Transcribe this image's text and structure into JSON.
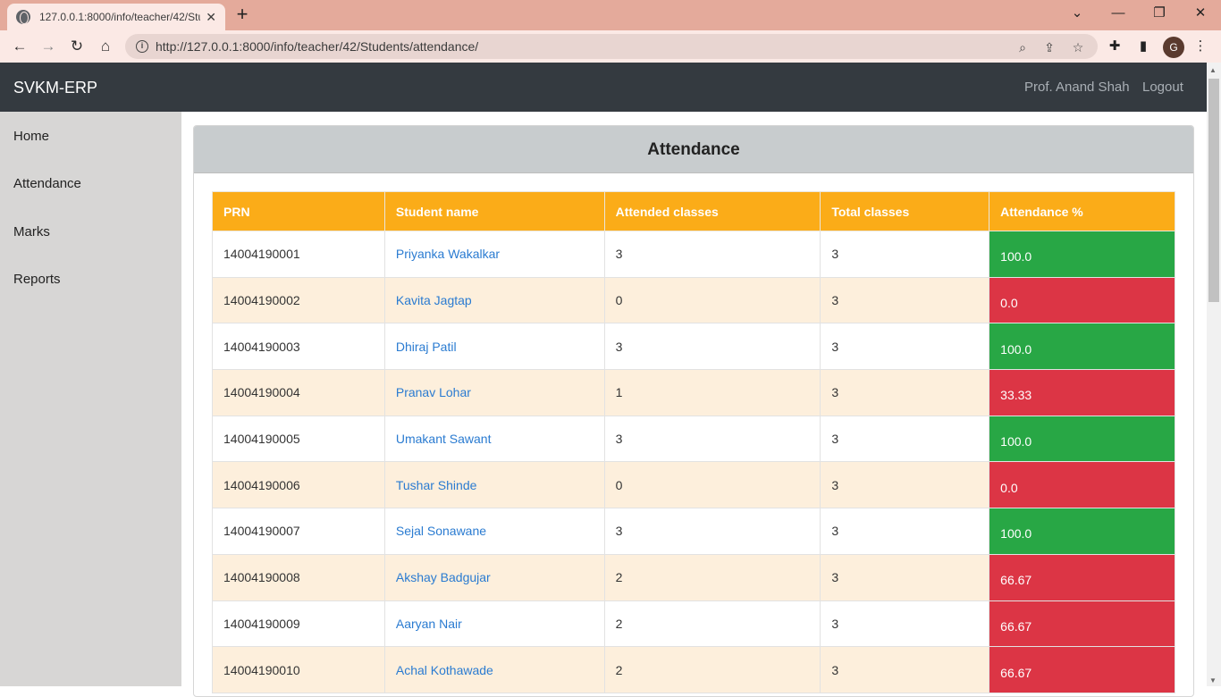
{
  "browser": {
    "tab_title": "127.0.0.1:8000/info/teacher/42/Stu",
    "url": "http://127.0.0.1:8000/info/teacher/42/Students/attendance/",
    "profile_initial": "G"
  },
  "app": {
    "brand": "SVKM-ERP",
    "user_name": "Prof. Anand Shah",
    "logout": "Logout"
  },
  "sidebar": {
    "items": [
      {
        "label": "Home"
      },
      {
        "label": "Attendance"
      },
      {
        "label": "Marks"
      },
      {
        "label": "Reports"
      }
    ]
  },
  "page": {
    "title": "Attendance"
  },
  "table": {
    "headers": [
      "PRN",
      "Student name",
      "Attended classes",
      "Total classes",
      "Attendance %"
    ],
    "rows": [
      {
        "prn": "14004190001",
        "name": "Priyanka Wakalkar",
        "attended": "3",
        "total": "3",
        "pct": "100.0",
        "status": "good"
      },
      {
        "prn": "14004190002",
        "name": "Kavita Jagtap",
        "attended": "0",
        "total": "3",
        "pct": "0.0",
        "status": "bad"
      },
      {
        "prn": "14004190003",
        "name": "Dhiraj Patil",
        "attended": "3",
        "total": "3",
        "pct": "100.0",
        "status": "good"
      },
      {
        "prn": "14004190004",
        "name": "Pranav Lohar",
        "attended": "1",
        "total": "3",
        "pct": "33.33",
        "status": "bad"
      },
      {
        "prn": "14004190005",
        "name": "Umakant Sawant",
        "attended": "3",
        "total": "3",
        "pct": "100.0",
        "status": "good"
      },
      {
        "prn": "14004190006",
        "name": "Tushar Shinde",
        "attended": "0",
        "total": "3",
        "pct": "0.0",
        "status": "bad"
      },
      {
        "prn": "14004190007",
        "name": "Sejal Sonawane",
        "attended": "3",
        "total": "3",
        "pct": "100.0",
        "status": "good"
      },
      {
        "prn": "14004190008",
        "name": "Akshay Badgujar",
        "attended": "2",
        "total": "3",
        "pct": "66.67",
        "status": "bad"
      },
      {
        "prn": "14004190009",
        "name": "Aaryan Nair",
        "attended": "2",
        "total": "3",
        "pct": "66.67",
        "status": "bad"
      },
      {
        "prn": "14004190010",
        "name": "Achal Kothawade",
        "attended": "2",
        "total": "3",
        "pct": "66.67",
        "status": "bad"
      }
    ]
  },
  "colors": {
    "navbar": "#343a40",
    "table_header": "#fbac18",
    "good": "#28a745",
    "bad": "#dc3545",
    "link": "#2a7bd1"
  }
}
